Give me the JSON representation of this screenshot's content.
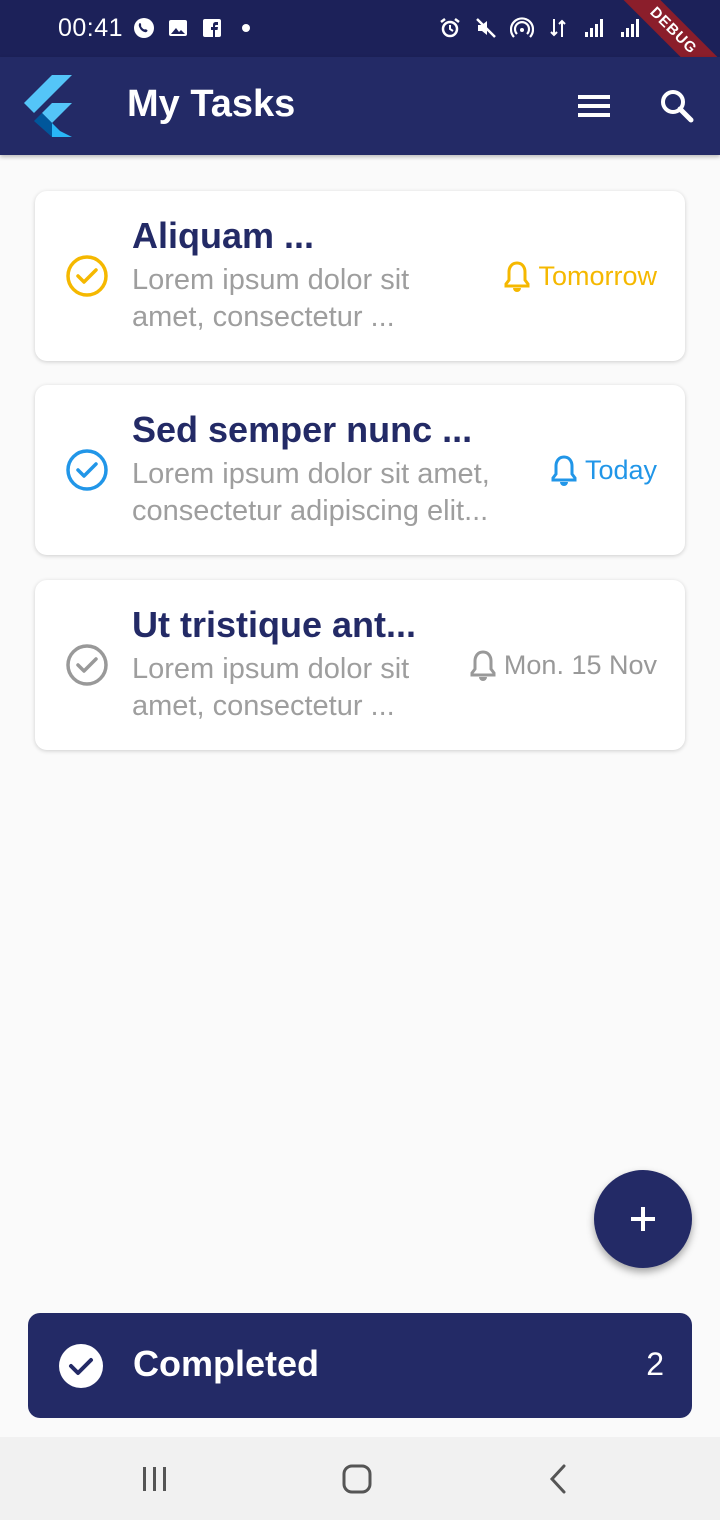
{
  "status_bar": {
    "time": "00:41",
    "left_icons": [
      "whatsapp-icon",
      "gallery-icon",
      "facebook-icon",
      "dot-icon"
    ],
    "right_icons": [
      "alarm-icon",
      "mute-icon",
      "hotspot-icon",
      "data-arrows-icon",
      "signal-icon",
      "signal-icon",
      "battery-icon"
    ],
    "debug_label": "DEBUG"
  },
  "app_bar": {
    "title": "My Tasks",
    "logo_icon": "flutter-logo",
    "actions": [
      "menu-icon",
      "search-icon"
    ]
  },
  "tasks": [
    {
      "title": "Aliquam ...",
      "description_line1": "Lorem ipsum dolor sit",
      "description_line2": "amet, consectetur ...",
      "reminder": "Tomorrow",
      "color": "#f5b800"
    },
    {
      "title": "Sed semper nunc ...",
      "description_line1": "Lorem ipsum dolor sit amet,",
      "description_line2": "consectetur adipiscing elit...",
      "reminder": "Today",
      "color": "#2196e8"
    },
    {
      "title": "Ut tristique ant...",
      "description_line1": "Lorem ipsum dolor sit",
      "description_line2": "amet, consectetur ...",
      "reminder": "Mon. 15 Nov",
      "color": "#999999"
    }
  ],
  "fab": {
    "icon": "plus-icon"
  },
  "completed": {
    "label": "Completed",
    "count": "2",
    "icon": "check-circle-icon"
  },
  "nav_bar": {
    "buttons": [
      "recents-icon",
      "home-icon",
      "back-icon"
    ]
  },
  "colors": {
    "primary": "#232a66",
    "status_bar": "#1c2159",
    "background": "#fafafa",
    "debug": "#8b1e2b"
  }
}
